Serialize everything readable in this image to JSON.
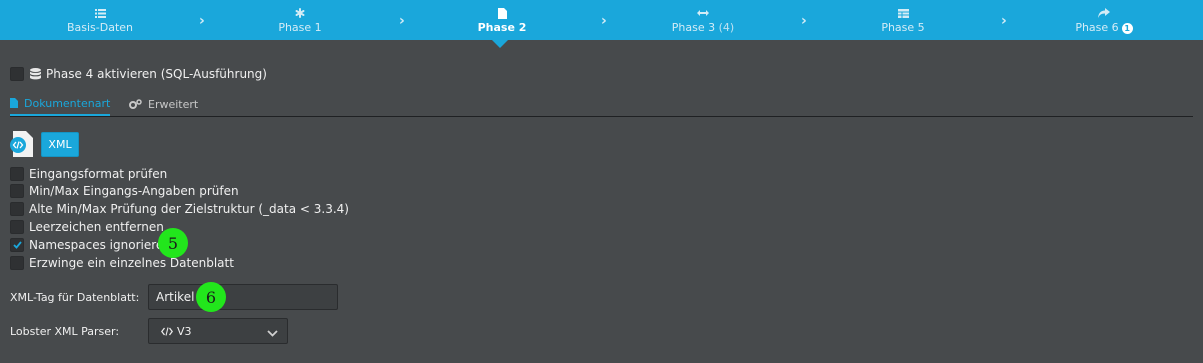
{
  "phases": [
    {
      "label": "Basis-Daten",
      "icon": "list-icon"
    },
    {
      "label": "Phase 1",
      "icon": "asterisk-icon"
    },
    {
      "label": "Phase 2",
      "icon": "file-icon"
    },
    {
      "label": "Phase 3",
      "count": "(4)",
      "icon": "arrows-horizontal-icon"
    },
    {
      "label": "Phase 5",
      "icon": "table-icon"
    },
    {
      "label": "Phase 6",
      "badge": "1",
      "icon": "share-arrow-icon"
    }
  ],
  "active_phase": "Phase 2",
  "sql_toggle": {
    "label": "Phase 4 aktivieren (SQL-Ausführung)",
    "checked": false
  },
  "tabs": [
    {
      "label": "Dokumentenart",
      "active": true
    },
    {
      "label": "Erweitert",
      "active": false
    }
  ],
  "doc_type": {
    "button": "XML"
  },
  "options": [
    {
      "label": "Eingangsformat prüfen",
      "checked": false
    },
    {
      "label": "Min/Max Eingangs-Angaben prüfen",
      "checked": false
    },
    {
      "label": "Alte Min/Max Prüfung der Zielstruktur (_data < 3.3.4)",
      "checked": false
    },
    {
      "label": "Leerzeichen entfernen",
      "checked": false
    },
    {
      "label": "Namespaces ignorieren",
      "checked": true
    },
    {
      "label": "Erzwinge ein einzelnes Datenblatt",
      "checked": false
    }
  ],
  "markers": {
    "namespaces": "5",
    "xml_tag": "6"
  },
  "fields": {
    "xml_tag": {
      "label": "XML-Tag für Datenblatt:",
      "value": "Artikel"
    },
    "parser": {
      "label": "Lobster XML Parser:",
      "value": "V3"
    }
  },
  "colors": {
    "accent": "#1aa7db",
    "background": "#474a4c",
    "marker": "#22e61c"
  }
}
